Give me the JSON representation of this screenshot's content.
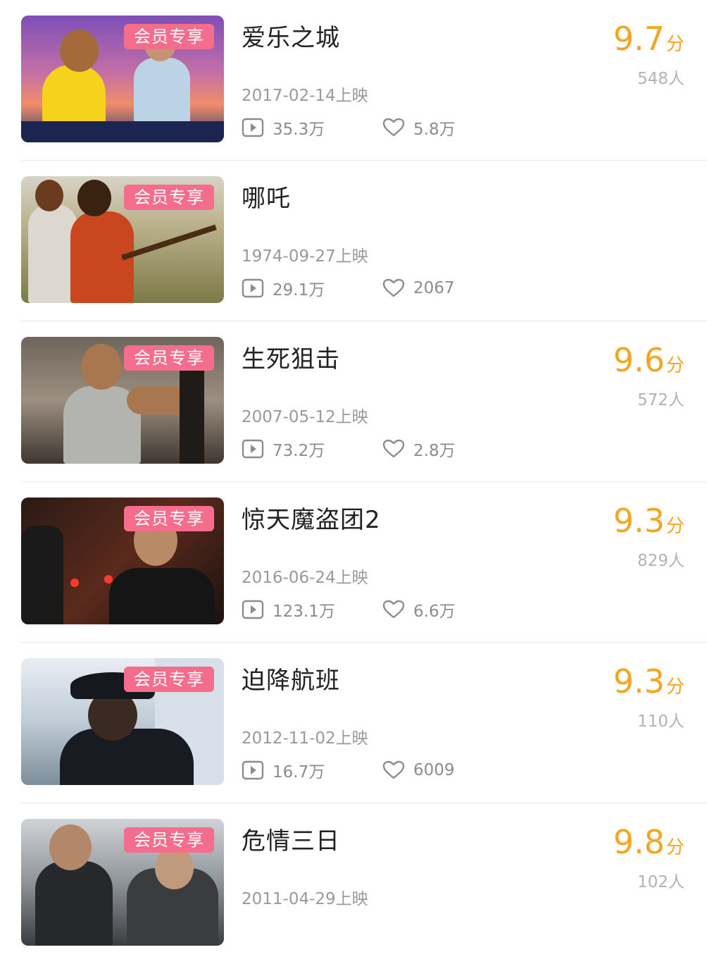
{
  "badge_label": "会员专享",
  "play_icon": "play-icon",
  "like_icon": "heart-icon",
  "accent_color": "#f2a623",
  "badge_color": "#f56d8c",
  "movies": [
    {
      "title": "爱乐之城",
      "release": "2017-02-14上映",
      "plays": "35.3万",
      "likes": "5.8万",
      "score": "9.7",
      "score_unit": "分",
      "raters": "548人",
      "show_score": true
    },
    {
      "title": "哪吒",
      "release": "1974-09-27上映",
      "plays": "29.1万",
      "likes": "2067",
      "score": "",
      "score_unit": "",
      "raters": "",
      "show_score": false
    },
    {
      "title": "生死狙击",
      "release": "2007-05-12上映",
      "plays": "73.2万",
      "likes": "2.8万",
      "score": "9.6",
      "score_unit": "分",
      "raters": "572人",
      "show_score": true
    },
    {
      "title": "惊天魔盗团2",
      "release": "2016-06-24上映",
      "plays": "123.1万",
      "likes": "6.6万",
      "score": "9.3",
      "score_unit": "分",
      "raters": "829人",
      "show_score": true
    },
    {
      "title": "迫降航班",
      "release": "2012-11-02上映",
      "plays": "16.7万",
      "likes": "6009",
      "score": "9.3",
      "score_unit": "分",
      "raters": "110人",
      "show_score": true
    },
    {
      "title": "危情三日",
      "release": "2011-04-29上映",
      "plays": "",
      "likes": "",
      "score": "9.8",
      "score_unit": "分",
      "raters": "102人",
      "show_score": true
    }
  ]
}
